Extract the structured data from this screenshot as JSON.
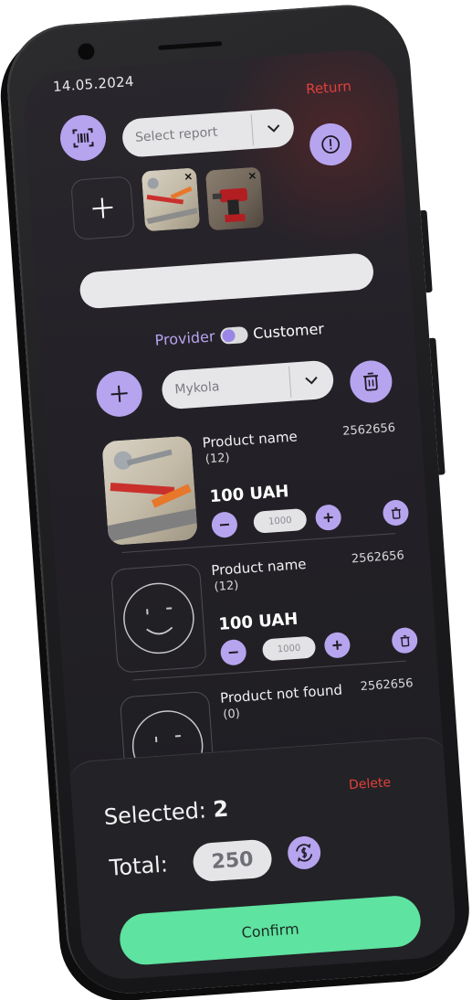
{
  "status": {
    "date": "14.05.2024"
  },
  "header": {
    "return_label": "Return"
  },
  "report": {
    "placeholder": "Select report"
  },
  "photos": [
    {
      "kind": "tools",
      "remove_glyph": "×"
    },
    {
      "kind": "drill",
      "remove_glyph": "×"
    }
  ],
  "mode": {
    "provider_label": "Provider",
    "customer_label": "Customer",
    "active": "Provider"
  },
  "person": {
    "selected": "Mykola"
  },
  "products": [
    {
      "name": "Product name",
      "count": "(12)",
      "code": "2562656",
      "price": "100 UAH",
      "quantity": "1000",
      "image": "tools"
    },
    {
      "name": "Product name",
      "count": "(12)",
      "code": "2562656",
      "price": "100 UAH",
      "quantity": "1000",
      "image": "placeholder"
    },
    {
      "name": "Product not found",
      "count": "(0)",
      "code": "2562656",
      "image": "placeholder"
    }
  ],
  "summary": {
    "selected_label": "Selected: ",
    "selected_count": "2",
    "delete_label": "Delete",
    "total_label": "Total:",
    "total_value": "250",
    "confirm_label": "Confirm"
  },
  "colors": {
    "accent": "#b7a4ef",
    "danger": "#e0403c",
    "confirm": "#5ee3a0",
    "background": "#232127"
  },
  "icons": [
    "barcode-scan-icon",
    "chevron-down-icon",
    "info-icon",
    "plus-icon",
    "trash-icon",
    "minus-icon",
    "currency-exchange-icon",
    "smiley-placeholder-icon"
  ]
}
